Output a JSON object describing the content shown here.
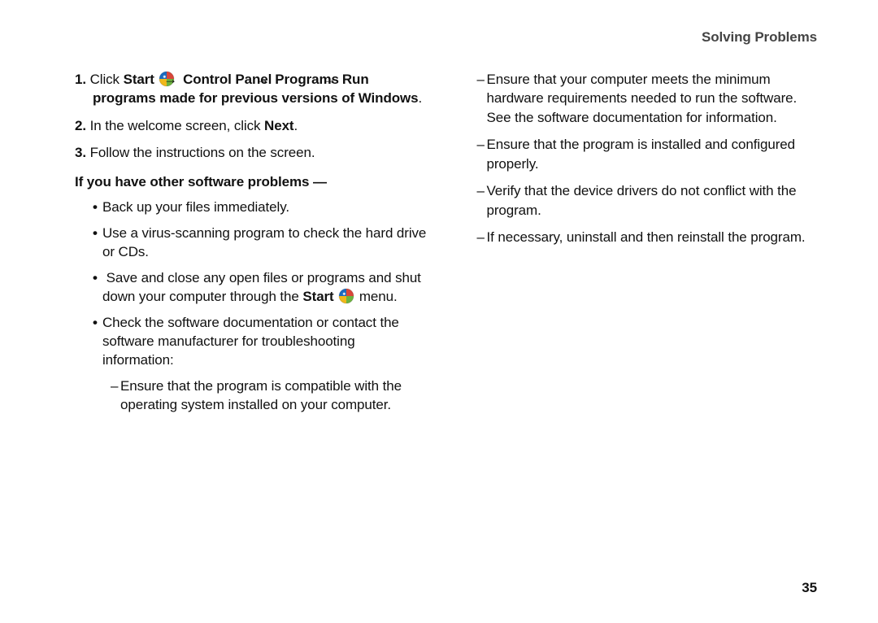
{
  "header": {
    "title": "Solving Problems"
  },
  "page_number": "35",
  "left": {
    "step1": {
      "num": "1.",
      "click": "Click ",
      "start": "Start",
      "arrow1": " → ",
      "control_panel": "Control Panel",
      "arrow2": "→ ",
      "programs": "Programs",
      "arrow3": "→ ",
      "run_programs": "Run programs made for previous versions of Windows",
      "period": "."
    },
    "step2": {
      "num": "2.",
      "pre": "In the welcome screen, click ",
      "next": "Next",
      "period": "."
    },
    "step3": {
      "num": "3.",
      "text": "Follow the instructions on the screen."
    },
    "subhead": "If you have other software problems —",
    "bullet1": "Back up your files immediately.",
    "bullet2": "Use a virus-scanning program to check the hard drive or CDs.",
    "bullet3": {
      "pre": "Save and close any open files or programs and shut down your computer through the ",
      "start": "Start",
      "post": "  menu."
    },
    "bullet4": "Check the software documentation or contact the software manufacturer for troubleshooting information:",
    "sub1": "Ensure that the program is compatible with the operating system installed on your computer."
  },
  "right": {
    "r1": "Ensure that your computer meets the minimum hardware requirements needed to run the software. See the software documentation for information.",
    "r2": "Ensure that the program is installed and configured properly.",
    "r3": "Verify that the device drivers do not conflict with the program.",
    "r4": "If necessary, uninstall and then reinstall the program."
  }
}
